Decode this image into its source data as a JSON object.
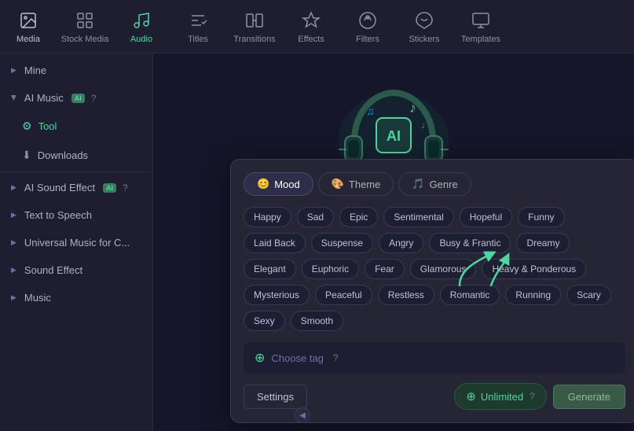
{
  "nav": {
    "items": [
      {
        "id": "media",
        "label": "Media",
        "icon": "media"
      },
      {
        "id": "stock-media",
        "label": "Stock Media",
        "icon": "stock"
      },
      {
        "id": "audio",
        "label": "Audio",
        "icon": "audio",
        "active": true
      },
      {
        "id": "titles",
        "label": "Titles",
        "icon": "titles"
      },
      {
        "id": "transitions",
        "label": "Transitions",
        "icon": "transitions"
      },
      {
        "id": "effects",
        "label": "Effects",
        "icon": "effects"
      },
      {
        "id": "filters",
        "label": "Filters",
        "icon": "filters"
      },
      {
        "id": "stickers",
        "label": "Stickers",
        "icon": "stickers"
      },
      {
        "id": "templates",
        "label": "Templates",
        "icon": "templates"
      }
    ]
  },
  "sidebar": {
    "items": [
      {
        "id": "mine",
        "label": "Mine",
        "type": "collapsible",
        "expanded": false
      },
      {
        "id": "ai-music",
        "label": "AI Music",
        "type": "collapsible",
        "expanded": true,
        "hasAI": true,
        "hasHelp": true
      },
      {
        "id": "tool",
        "label": "Tool",
        "type": "sub",
        "icon": "tool"
      },
      {
        "id": "downloads",
        "label": "Downloads",
        "type": "sub",
        "icon": "download"
      },
      {
        "id": "ai-sound-effect",
        "label": "AI Sound Effect",
        "type": "collapsible",
        "expanded": false,
        "hasAI": true,
        "hasHelp": true
      },
      {
        "id": "text-to-speech",
        "label": "Text to Speech",
        "type": "collapsible",
        "expanded": false
      },
      {
        "id": "universal-music",
        "label": "Universal Music for C...",
        "type": "collapsible",
        "expanded": false
      },
      {
        "id": "sound-effect",
        "label": "Sound Effect",
        "type": "collapsible",
        "expanded": false
      },
      {
        "id": "music",
        "label": "Music",
        "type": "collapsible",
        "expanded": false
      }
    ]
  },
  "popup": {
    "tabs": [
      {
        "id": "mood",
        "label": "Mood",
        "icon": "😊",
        "active": true
      },
      {
        "id": "theme",
        "label": "Theme",
        "icon": "🎨",
        "active": false
      },
      {
        "id": "genre",
        "label": "Genre",
        "icon": "🎵",
        "active": false
      }
    ],
    "tags": [
      "Happy",
      "Sad",
      "Epic",
      "Sentimental",
      "Hopeful",
      "Funny",
      "Laid Back",
      "Suspense",
      "Angry",
      "Busy & Frantic",
      "Dreamy",
      "Elegant",
      "Euphoric",
      "Fear",
      "Glamorous",
      "Heavy & Ponderous",
      "Mysterious",
      "Peaceful",
      "Restless",
      "Romantic",
      "Running",
      "Scary",
      "Sexy",
      "Smooth"
    ],
    "chooseTag": {
      "label": "Choose tag",
      "helpIcon": "?"
    },
    "buttons": {
      "settings": "Settings",
      "unlimited": "Unlimited",
      "generate": "Generate"
    }
  }
}
